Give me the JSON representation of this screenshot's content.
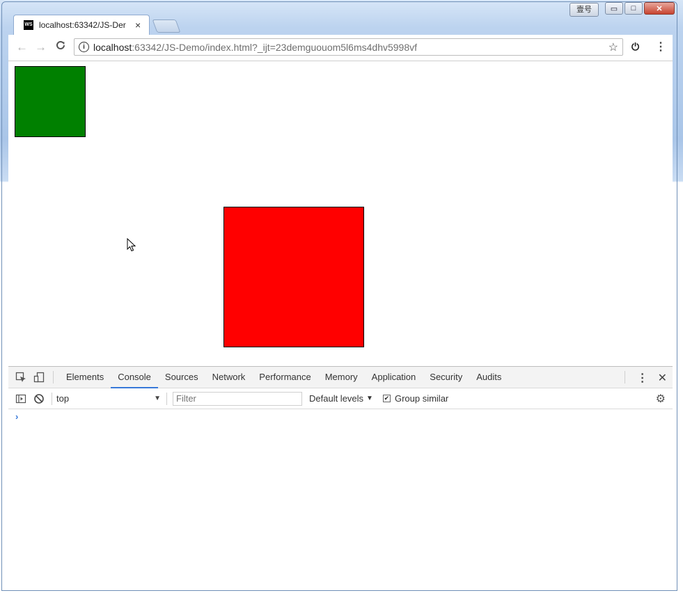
{
  "window": {
    "ime_label": "壹号",
    "min_label": "▭",
    "max_label": "□",
    "close_label": "✕"
  },
  "tab": {
    "favicon": "WS",
    "title": "localhost:63342/JS-Der",
    "close": "×"
  },
  "toolbar": {
    "back_icon": "←",
    "forward_icon": "→",
    "reload_icon": "C",
    "url_host": "localhost",
    "url_rest": ":63342/JS-Demo/index.html?_ijt=23demguouom5l6ms4dhv5998vf",
    "info_icon": "i",
    "star_icon": "☆",
    "extension_icon": "⏻",
    "menu_icon": "⋮"
  },
  "page": {
    "green_color": "#008000",
    "red_color": "#ff0000"
  },
  "devtools": {
    "tabs": [
      "Elements",
      "Console",
      "Sources",
      "Network",
      "Performance",
      "Memory",
      "Application",
      "Security",
      "Audits"
    ],
    "active_tab": "Console",
    "kebab": "⋮",
    "close": "✕",
    "console": {
      "context": "top",
      "context_arrow": "▼",
      "filter_placeholder": "Filter",
      "levels_label": "Default levels",
      "levels_arrow": "▼",
      "group_similar_label": "Group similar",
      "group_similar_checked": "✔",
      "prompt": "›",
      "gear_icon": "⚙"
    }
  }
}
